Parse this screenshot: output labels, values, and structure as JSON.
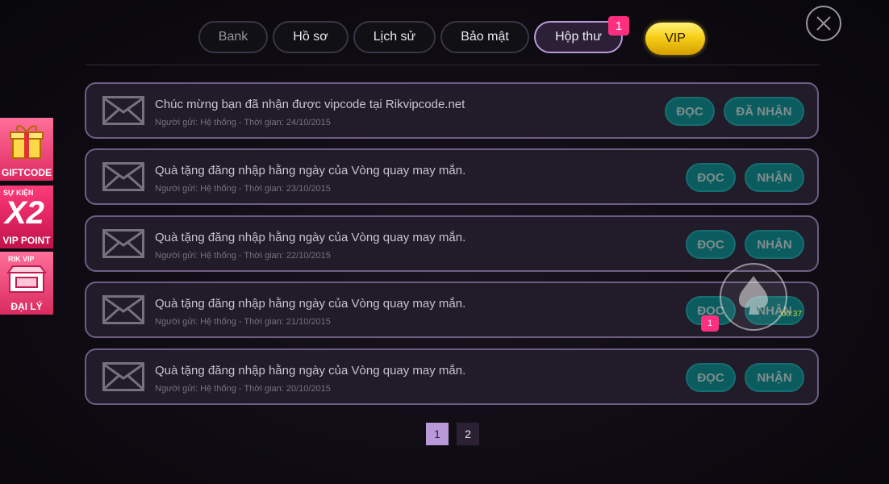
{
  "tabs": {
    "bank": "Bank",
    "profile": "Hồ sơ",
    "history": "Lịch sử",
    "security": "Bảo mật",
    "inbox": "Hộp thư",
    "inbox_badge": "1",
    "vip": "VIP"
  },
  "messages": [
    {
      "title": "Chúc mừng bạn đã nhận được vipcode tại Rikvipcode.net",
      "meta": "Người gửi: Hệ thống - Thời gian: 24/10/2015",
      "read_label": "ĐỌC",
      "claim_label": "ĐÃ NHẬN"
    },
    {
      "title": "Quà tặng đăng nhập hằng ngày của Vòng quay may mắn.",
      "meta": "Người gửi: Hệ thống - Thời gian: 23/10/2015",
      "read_label": "ĐỌC",
      "claim_label": "NHẬN"
    },
    {
      "title": "Quà tặng đăng nhập hằng ngày của Vòng quay may mắn.",
      "meta": "Người gửi: Hệ thống - Thời gian: 22/10/2015",
      "read_label": "ĐỌC",
      "claim_label": "NHẬN"
    },
    {
      "title": "Quà tặng đăng nhập hằng ngày của Vòng quay may mắn.",
      "meta": "Người gửi: Hệ thống - Thời gian: 21/10/2015",
      "read_label": "ĐỌC",
      "claim_label": "NHẬN"
    },
    {
      "title": "Quà tặng đăng nhập hằng ngày của Vòng quay may mắn.",
      "meta": "Người gửi: Hệ thống - Thời gian: 20/10/2015",
      "read_label": "ĐỌC",
      "claim_label": "NHẬN"
    }
  ],
  "pagination": {
    "current": "1",
    "next": "2"
  },
  "promos": {
    "giftcode": "GIFTCODE",
    "event_top": "SỰ KIỆN",
    "event_big": "X2",
    "event_bottom": "VIP POINT",
    "agent_top": "RIK VIP",
    "agent": "ĐẠI LÝ"
  },
  "overlay": {
    "timer": "00:37",
    "badge": "1"
  },
  "icons": {
    "close": "close-icon",
    "envelope": "envelope-icon"
  },
  "colors": {
    "accent": "#b99ad8",
    "action_button": "#0b5c5e",
    "badge": "#ff2e7e",
    "vip_gold": "#f6cf18"
  }
}
